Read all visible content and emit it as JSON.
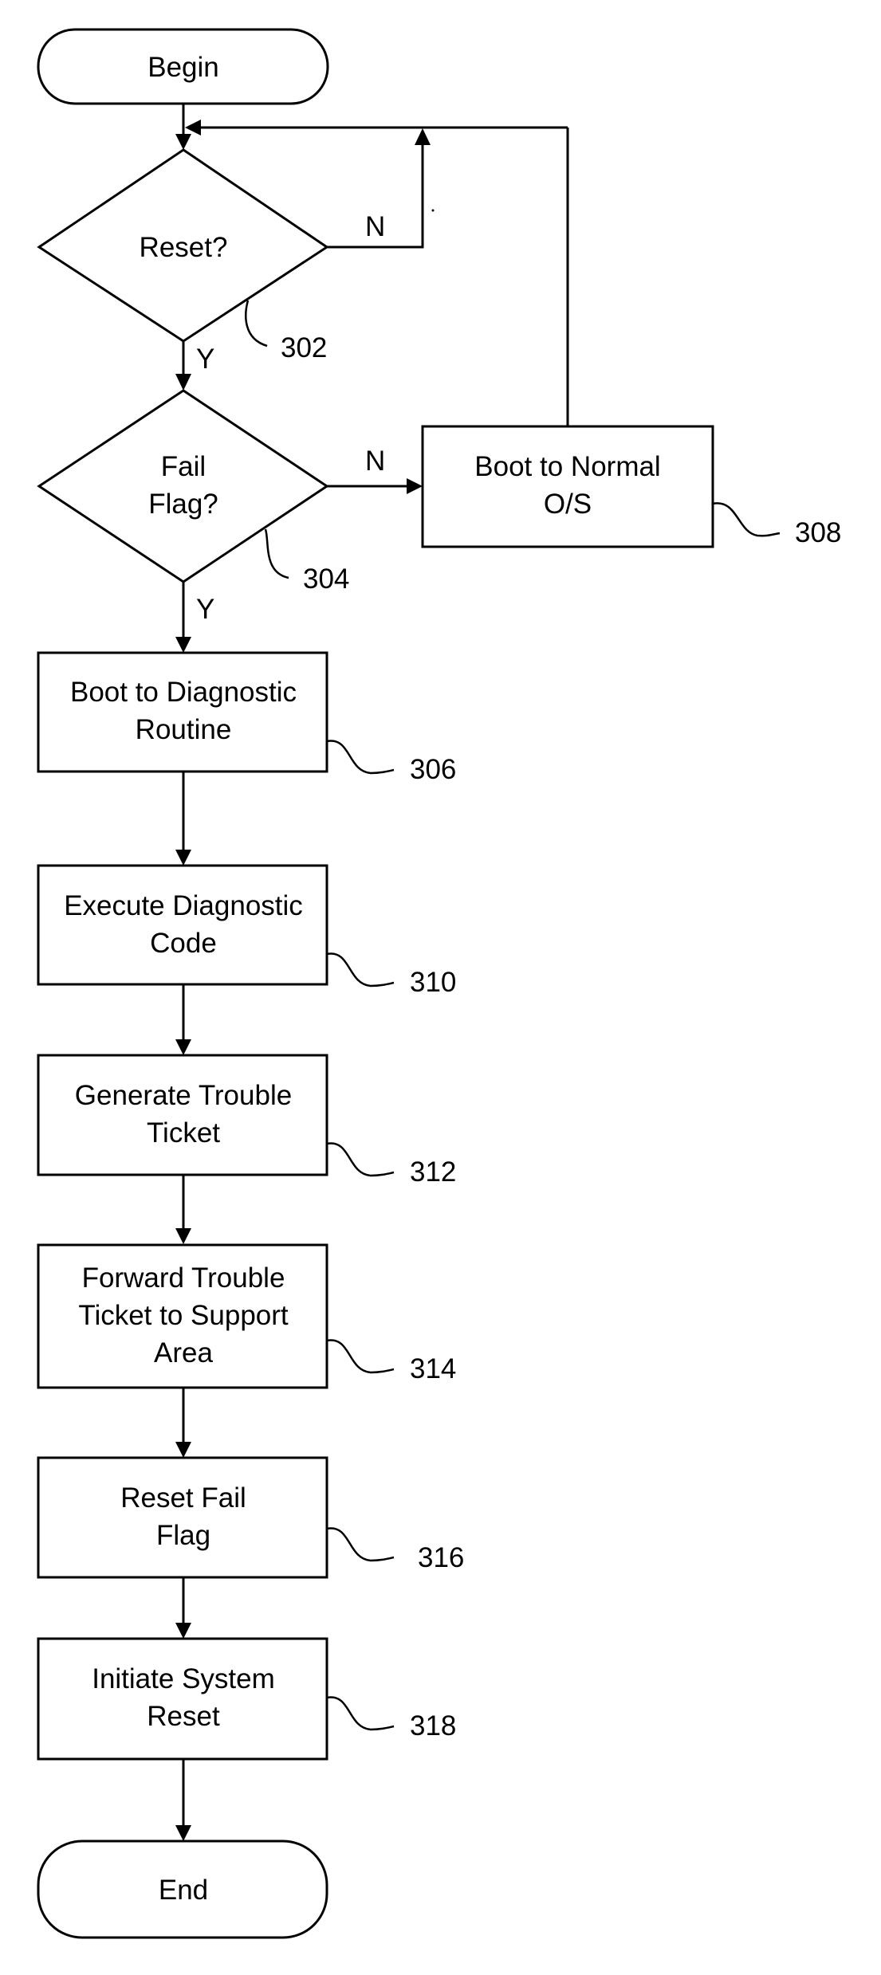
{
  "diagram": {
    "type": "flowchart",
    "nodes": {
      "begin": {
        "shape": "terminal",
        "lines": [
          "Begin"
        ]
      },
      "reset_decision": {
        "shape": "decision",
        "lines": [
          "Reset?"
        ],
        "ref": "302"
      },
      "fail_flag_decision": {
        "shape": "decision",
        "lines": [
          "Fail",
          "Flag?"
        ],
        "ref": "304"
      },
      "boot_normal": {
        "shape": "process",
        "lines": [
          "Boot to Normal",
          "O/S"
        ],
        "ref": "308"
      },
      "boot_diagnostic": {
        "shape": "process",
        "lines": [
          "Boot to Diagnostic",
          "Routine"
        ],
        "ref": "306"
      },
      "execute_diagnostic": {
        "shape": "process",
        "lines": [
          "Execute Diagnostic",
          "Code"
        ],
        "ref": "310"
      },
      "generate_ticket": {
        "shape": "process",
        "lines": [
          "Generate Trouble",
          "Ticket"
        ],
        "ref": "312"
      },
      "forward_ticket": {
        "shape": "process",
        "lines": [
          "Forward Trouble",
          "Ticket to Support",
          "Area"
        ],
        "ref": "314"
      },
      "reset_fail_flag": {
        "shape": "process",
        "lines": [
          "Reset Fail",
          "Flag"
        ],
        "ref": "316"
      },
      "initiate_reset": {
        "shape": "process",
        "lines": [
          "Initiate System",
          "Reset"
        ],
        "ref": "318"
      },
      "end": {
        "shape": "terminal",
        "lines": [
          "End"
        ]
      }
    },
    "edges": [
      {
        "from": "begin",
        "to": "reset_decision",
        "label": ""
      },
      {
        "from": "reset_decision",
        "to": "reset_decision",
        "label": "N"
      },
      {
        "from": "reset_decision",
        "to": "fail_flag_decision",
        "label": "Y"
      },
      {
        "from": "fail_flag_decision",
        "to": "boot_normal",
        "label": "N"
      },
      {
        "from": "boot_normal",
        "to": "reset_decision",
        "label": ""
      },
      {
        "from": "fail_flag_decision",
        "to": "boot_diagnostic",
        "label": "Y"
      },
      {
        "from": "boot_diagnostic",
        "to": "execute_diagnostic",
        "label": ""
      },
      {
        "from": "execute_diagnostic",
        "to": "generate_ticket",
        "label": ""
      },
      {
        "from": "generate_ticket",
        "to": "forward_ticket",
        "label": ""
      },
      {
        "from": "forward_ticket",
        "to": "reset_fail_flag",
        "label": ""
      },
      {
        "from": "reset_fail_flag",
        "to": "initiate_reset",
        "label": ""
      },
      {
        "from": "initiate_reset",
        "to": "end",
        "label": ""
      }
    ],
    "branch_labels": {
      "reset_no": "N",
      "reset_yes": "Y",
      "fail_no": "N",
      "fail_yes": "Y"
    }
  }
}
